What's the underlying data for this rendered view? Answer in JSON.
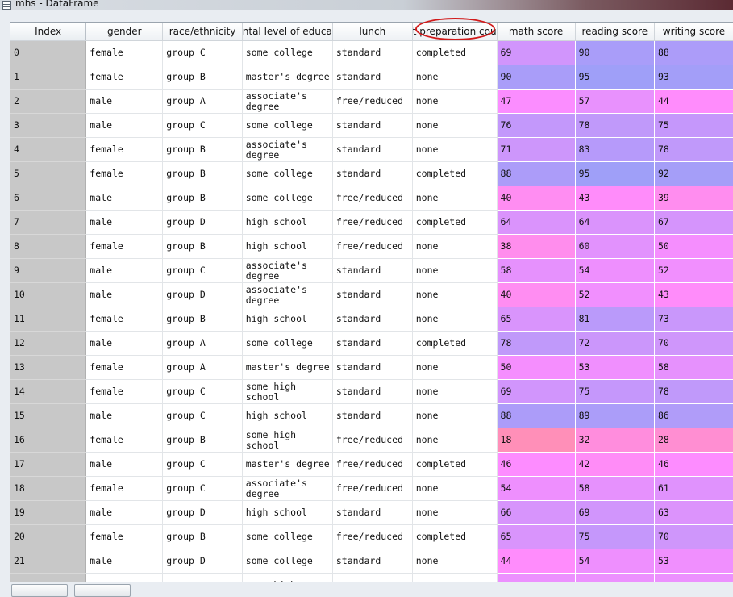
{
  "window": {
    "title": "mhs - DataFrame",
    "icon": "table-icon"
  },
  "columns": [
    "Index",
    "gender",
    "race/ethnicity",
    "ntal level of educa",
    "lunch",
    "t preparation cou",
    "math score",
    "reading score",
    "writing score"
  ],
  "rows": [
    [
      "0",
      "female",
      "group C",
      "some college",
      "standard",
      "completed",
      "69",
      "90",
      "88"
    ],
    [
      "1",
      "female",
      "group B",
      "master's degree",
      "standard",
      "none",
      "90",
      "95",
      "93"
    ],
    [
      "2",
      "male",
      "group A",
      "associate's degree",
      "free/reduced",
      "none",
      "47",
      "57",
      "44"
    ],
    [
      "3",
      "male",
      "group C",
      "some college",
      "standard",
      "none",
      "76",
      "78",
      "75"
    ],
    [
      "4",
      "female",
      "group B",
      "associate's degree",
      "standard",
      "none",
      "71",
      "83",
      "78"
    ],
    [
      "5",
      "female",
      "group B",
      "some college",
      "standard",
      "completed",
      "88",
      "95",
      "92"
    ],
    [
      "6",
      "male",
      "group B",
      "some college",
      "free/reduced",
      "none",
      "40",
      "43",
      "39"
    ],
    [
      "7",
      "male",
      "group D",
      "high school",
      "free/reduced",
      "completed",
      "64",
      "64",
      "67"
    ],
    [
      "8",
      "female",
      "group B",
      "high school",
      "free/reduced",
      "none",
      "38",
      "60",
      "50"
    ],
    [
      "9",
      "male",
      "group C",
      "associate's degree",
      "standard",
      "none",
      "58",
      "54",
      "52"
    ],
    [
      "10",
      "male",
      "group D",
      "associate's degree",
      "standard",
      "none",
      "40",
      "52",
      "43"
    ],
    [
      "11",
      "female",
      "group B",
      "high school",
      "standard",
      "none",
      "65",
      "81",
      "73"
    ],
    [
      "12",
      "male",
      "group A",
      "some college",
      "standard",
      "completed",
      "78",
      "72",
      "70"
    ],
    [
      "13",
      "female",
      "group A",
      "master's degree",
      "standard",
      "none",
      "50",
      "53",
      "58"
    ],
    [
      "14",
      "female",
      "group C",
      "some high school",
      "standard",
      "none",
      "69",
      "75",
      "78"
    ],
    [
      "15",
      "male",
      "group C",
      "high school",
      "standard",
      "none",
      "88",
      "89",
      "86"
    ],
    [
      "16",
      "female",
      "group B",
      "some high school",
      "free/reduced",
      "none",
      "18",
      "32",
      "28"
    ],
    [
      "17",
      "male",
      "group C",
      "master's degree",
      "free/reduced",
      "completed",
      "46",
      "42",
      "46"
    ],
    [
      "18",
      "female",
      "group C",
      "associate's degree",
      "free/reduced",
      "none",
      "54",
      "58",
      "61"
    ],
    [
      "19",
      "male",
      "group D",
      "high school",
      "standard",
      "none",
      "66",
      "69",
      "63"
    ],
    [
      "20",
      "female",
      "group B",
      "some college",
      "free/reduced",
      "completed",
      "65",
      "75",
      "70"
    ],
    [
      "21",
      "male",
      "group D",
      "some college",
      "standard",
      "none",
      "44",
      "54",
      "53"
    ],
    [
      "",
      "",
      "",
      "some high",
      "",
      "",
      "",
      "",
      ""
    ]
  ],
  "colors": {
    "score_low": "#ff8fb8",
    "score_mid": "#ff8cff",
    "score_high": "#9f9ff8",
    "highlight_circle": "#d11a1a",
    "index_bg": "#c8c8c8"
  }
}
